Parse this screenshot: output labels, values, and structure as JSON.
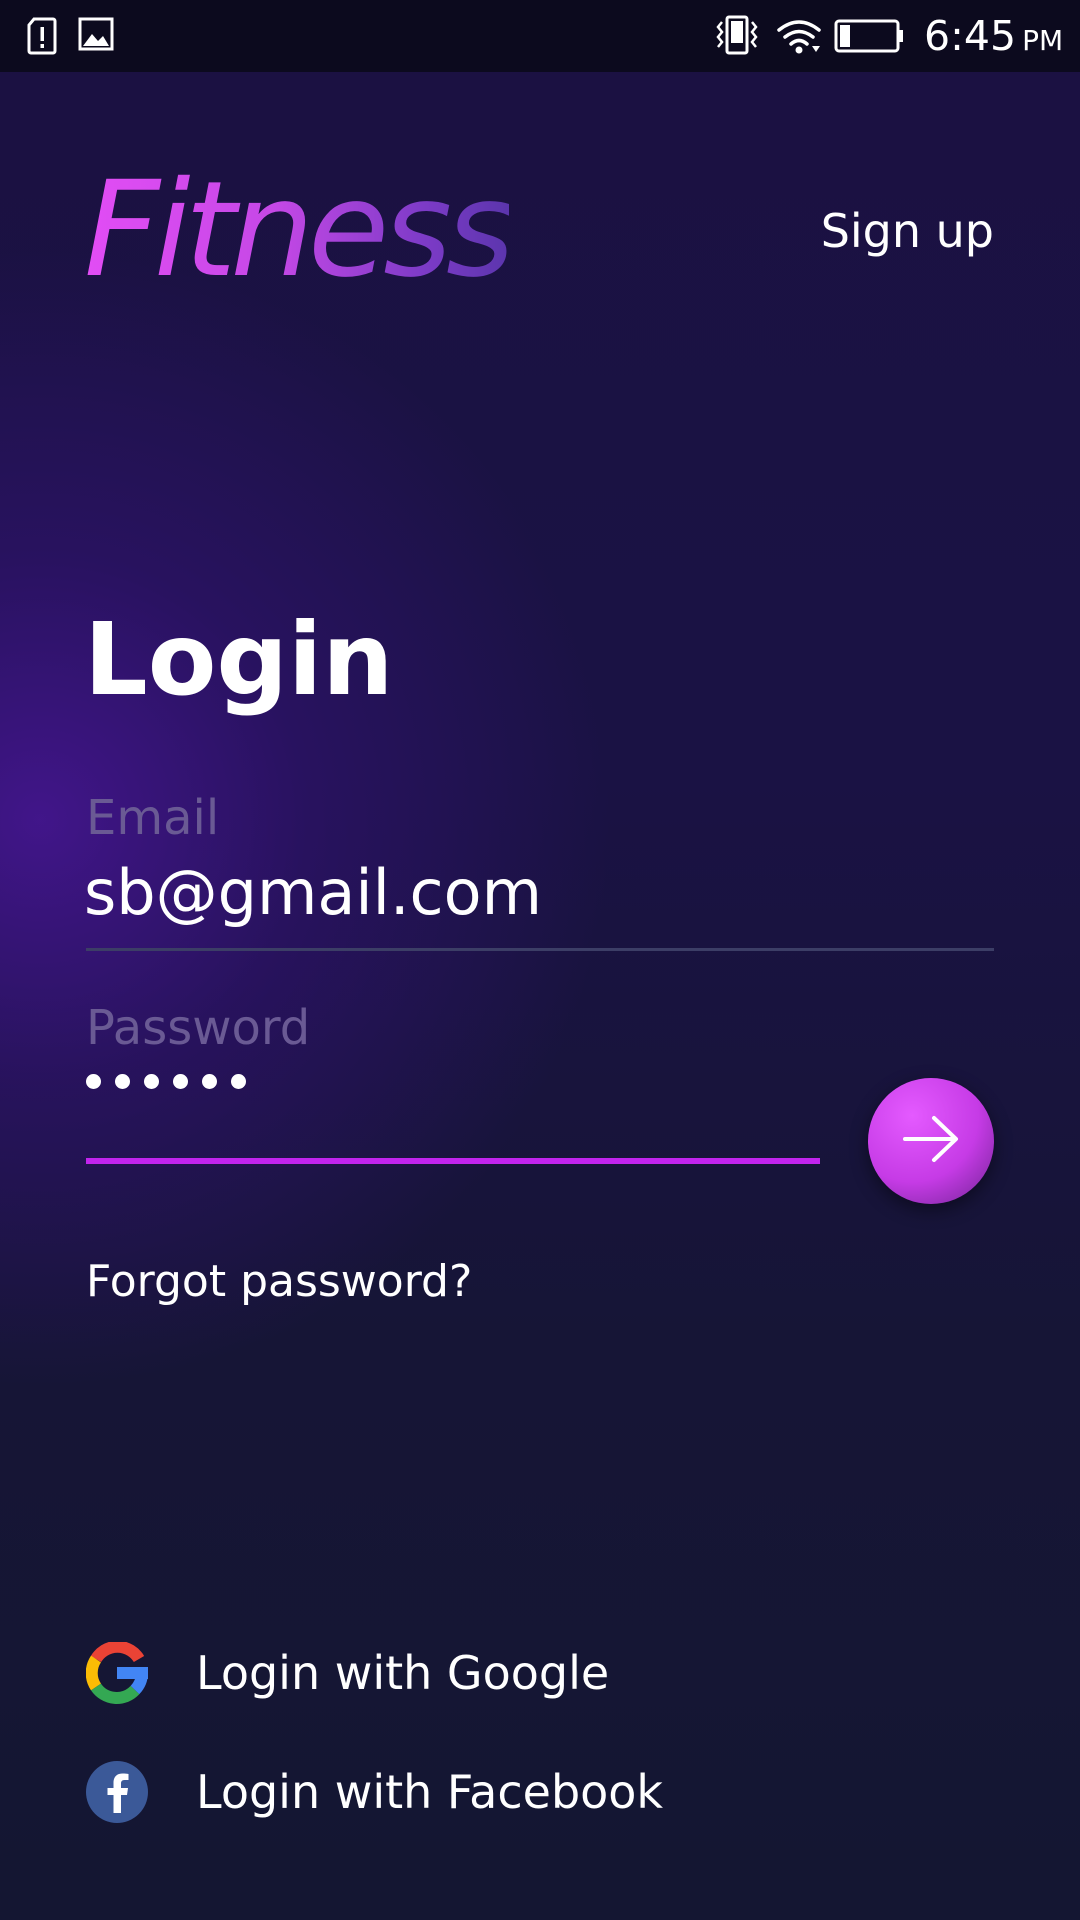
{
  "status_bar": {
    "time": "6:45",
    "ampm": "PM",
    "icons": [
      "sd-alert-icon",
      "image-icon",
      "vibrate-icon",
      "wifi-icon",
      "battery-icon"
    ]
  },
  "header": {
    "logo_text": "Fitness",
    "signup_label": "Sign up"
  },
  "login": {
    "title": "Login",
    "email_label": "Email",
    "email_value": "sb@gmail.com",
    "password_label": "Password",
    "password_length": 6,
    "submit_icon": "arrow-right-icon",
    "forgot_label": "Forgot password?"
  },
  "social": [
    {
      "label": "Login with Google",
      "icon": "google-icon"
    },
    {
      "label": "Login with Facebook",
      "icon": "facebook-icon"
    }
  ],
  "colors": {
    "accent": "#c224ee",
    "logo_gradient_start": "#e24df5",
    "logo_gradient_end": "#5b35ad",
    "background": "#1a1244",
    "label": "#6a5a94",
    "facebook": "#3b5998"
  }
}
